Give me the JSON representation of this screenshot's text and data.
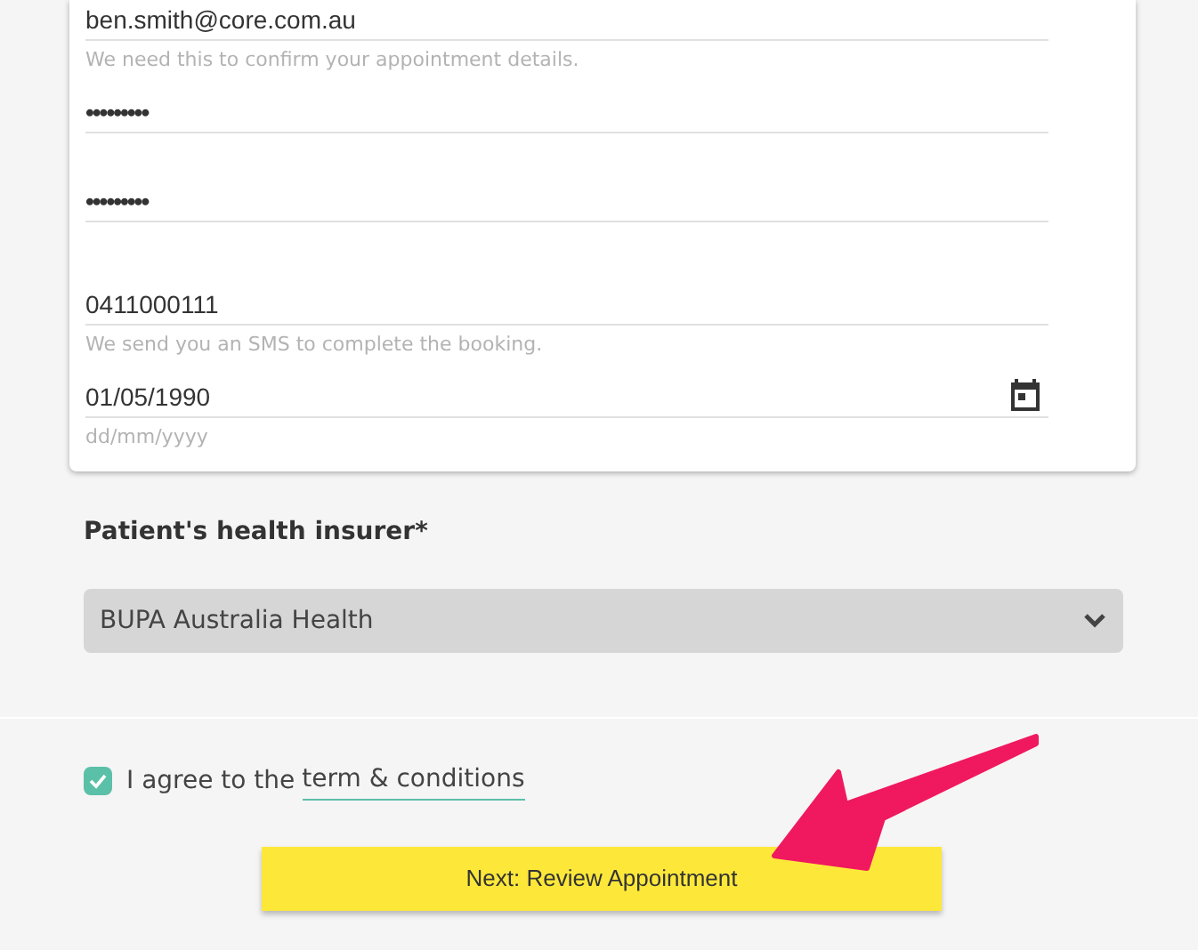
{
  "fields": [
    {
      "kind": "text",
      "value": "ben.smith@core.com.au",
      "helper": "We need this to confirm your appointment details."
    },
    {
      "kind": "password",
      "value": "•••••••••"
    },
    {
      "kind": "password",
      "value": "•••••••••"
    },
    {
      "kind": "text",
      "value": "0411000111",
      "helper": "We send you an SMS to complete the booking."
    },
    {
      "kind": "date",
      "value": "01/05/1990",
      "helper": "dd/mm/yyyy"
    }
  ],
  "insurer": {
    "label": "Patient's health insurer*",
    "value": "BUPA Australia Health"
  },
  "agree": {
    "checked": true,
    "text": "I agree to the",
    "link": "term & conditions"
  },
  "next_button": "Next: Review Appointment"
}
